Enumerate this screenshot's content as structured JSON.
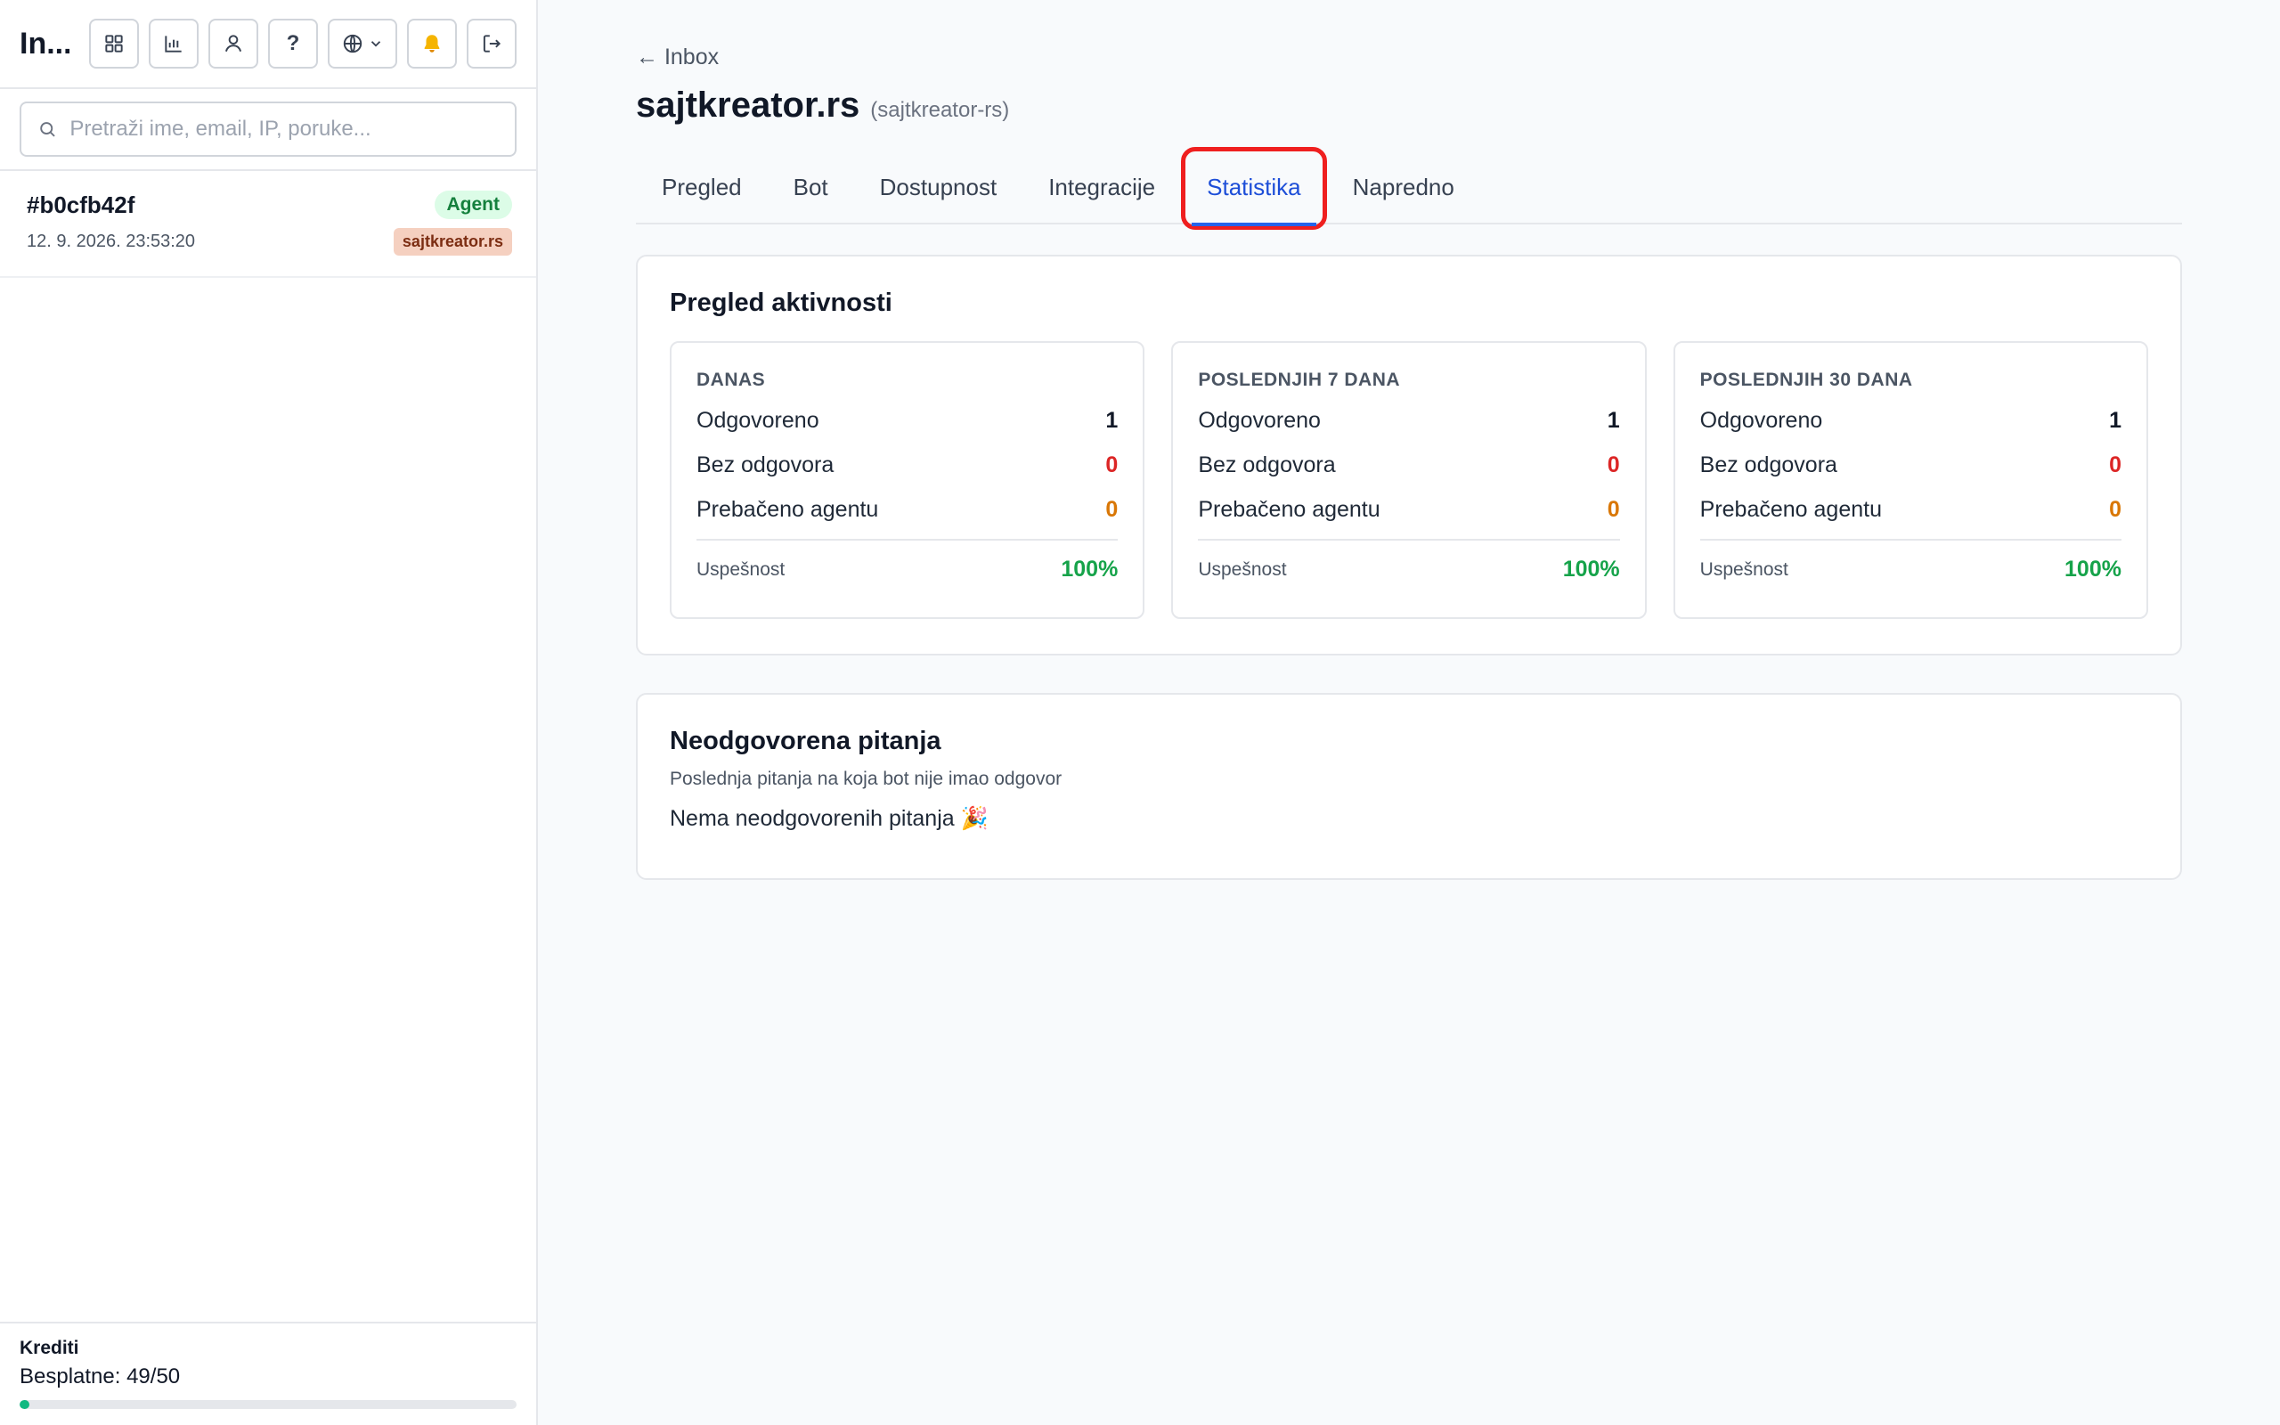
{
  "sidebar": {
    "title": "In...",
    "icons": [
      "dashboard-icon",
      "bar-chart-icon",
      "user-icon",
      "help-icon",
      "globe-icon",
      "bell-icon",
      "logout-icon"
    ],
    "help_label": "?",
    "search": {
      "placeholder": "Pretraži ime, email, IP, poruke...",
      "value": ""
    },
    "conversations": [
      {
        "id": "#b0cfb42f",
        "time": "12. 9. 2026. 23:53:20",
        "status": "Agent",
        "site": "sajtkreator.rs"
      }
    ],
    "credits": {
      "label": "Krediti",
      "value": "Besplatne: 49/50",
      "used": 49,
      "total": 50
    }
  },
  "main": {
    "back": "← Inbox",
    "title": "sajtkreator.rs",
    "slug": "(sajtkreator-rs)",
    "tabs": [
      "Pregled",
      "Bot",
      "Dostupnost",
      "Integracije",
      "Statistika",
      "Napredno"
    ],
    "active_tab": "Statistika",
    "activity": {
      "title": "Pregled aktivnosti",
      "periods": [
        {
          "label": "DANAS",
          "answered_label": "Odgovoreno",
          "answered": "1",
          "unanswered_label": "Bez odgovora",
          "unanswered": "0",
          "handoff_label": "Prebačeno agentu",
          "handoff": "0",
          "success_label": "Uspešnost",
          "success": "100%"
        },
        {
          "label": "POSLEDNJIH 7 DANA",
          "answered_label": "Odgovoreno",
          "answered": "1",
          "unanswered_label": "Bez odgovora",
          "unanswered": "0",
          "handoff_label": "Prebačeno agentu",
          "handoff": "0",
          "success_label": "Uspešnost",
          "success": "100%"
        },
        {
          "label": "POSLEDNJIH 30 DANA",
          "answered_label": "Odgovoreno",
          "answered": "1",
          "unanswered_label": "Bez odgovora",
          "unanswered": "0",
          "handoff_label": "Prebačeno agentu",
          "handoff": "0",
          "success_label": "Uspešnost",
          "success": "100%"
        }
      ]
    },
    "questions": {
      "title": "Neodgovorena pitanja",
      "subtitle": "Poslednja pitanja na koja bot nije imao odgovor",
      "empty": "Nema neodgovorenih pitanja 🎉"
    }
  },
  "colors": {
    "accent": "#2563eb",
    "highlight": "#ef1f1f",
    "success": "#16a34a",
    "danger": "#dc2626",
    "warning": "#d97706"
  }
}
